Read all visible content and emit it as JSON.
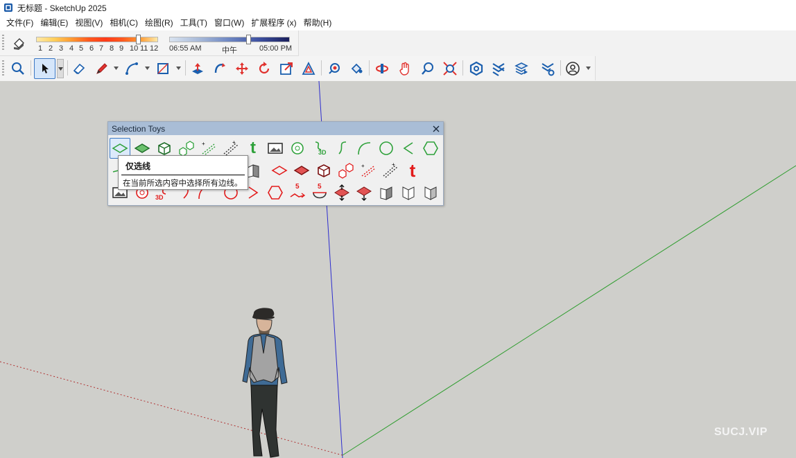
{
  "window": {
    "title": "无标题 - SketchUp 2025"
  },
  "menu": [
    "文件(F)",
    "编辑(E)",
    "视图(V)",
    "相机(C)",
    "绘图(R)",
    "工具(T)",
    "窗口(W)",
    "扩展程序 (x)",
    "帮助(H)"
  ],
  "shadows": {
    "months": [
      "1",
      "2",
      "3",
      "4",
      "5",
      "6",
      "7",
      "8",
      "9",
      "10",
      "11",
      "12"
    ],
    "month_value_fraction": 0.85,
    "time_labels": [
      "06:55 AM",
      "中午",
      "05:00 PM"
    ],
    "time_value_fraction": 0.7
  },
  "main_toolbar": {
    "tools": [
      "zoom-extents",
      "select",
      "eraser",
      "pencil",
      "arc",
      "rectangle",
      "push-pull",
      "follow-me",
      "move",
      "rotate",
      "scale",
      "offset",
      "tape-measure",
      "text",
      "orbit",
      "pan",
      "zoom",
      "zoom-window",
      "section-plane",
      "solid-tools",
      "layers",
      "styles",
      "components",
      "account"
    ]
  },
  "selection_toys": {
    "title": "Selection Toys",
    "tooltip_title": "仅选线",
    "tooltip_body": "在当前所选内容中选择所有边线。",
    "badge_3d": "3D",
    "badge_5": "5",
    "glyph_t": "t"
  },
  "watermark": "SUCJ.VIP",
  "colors": {
    "accent_red": "#e21b1b",
    "accent_green": "#2ea13a",
    "axis_blue": "#2c2ccf",
    "axis_green": "#2f9d2f",
    "axis_red": "#b03030"
  }
}
